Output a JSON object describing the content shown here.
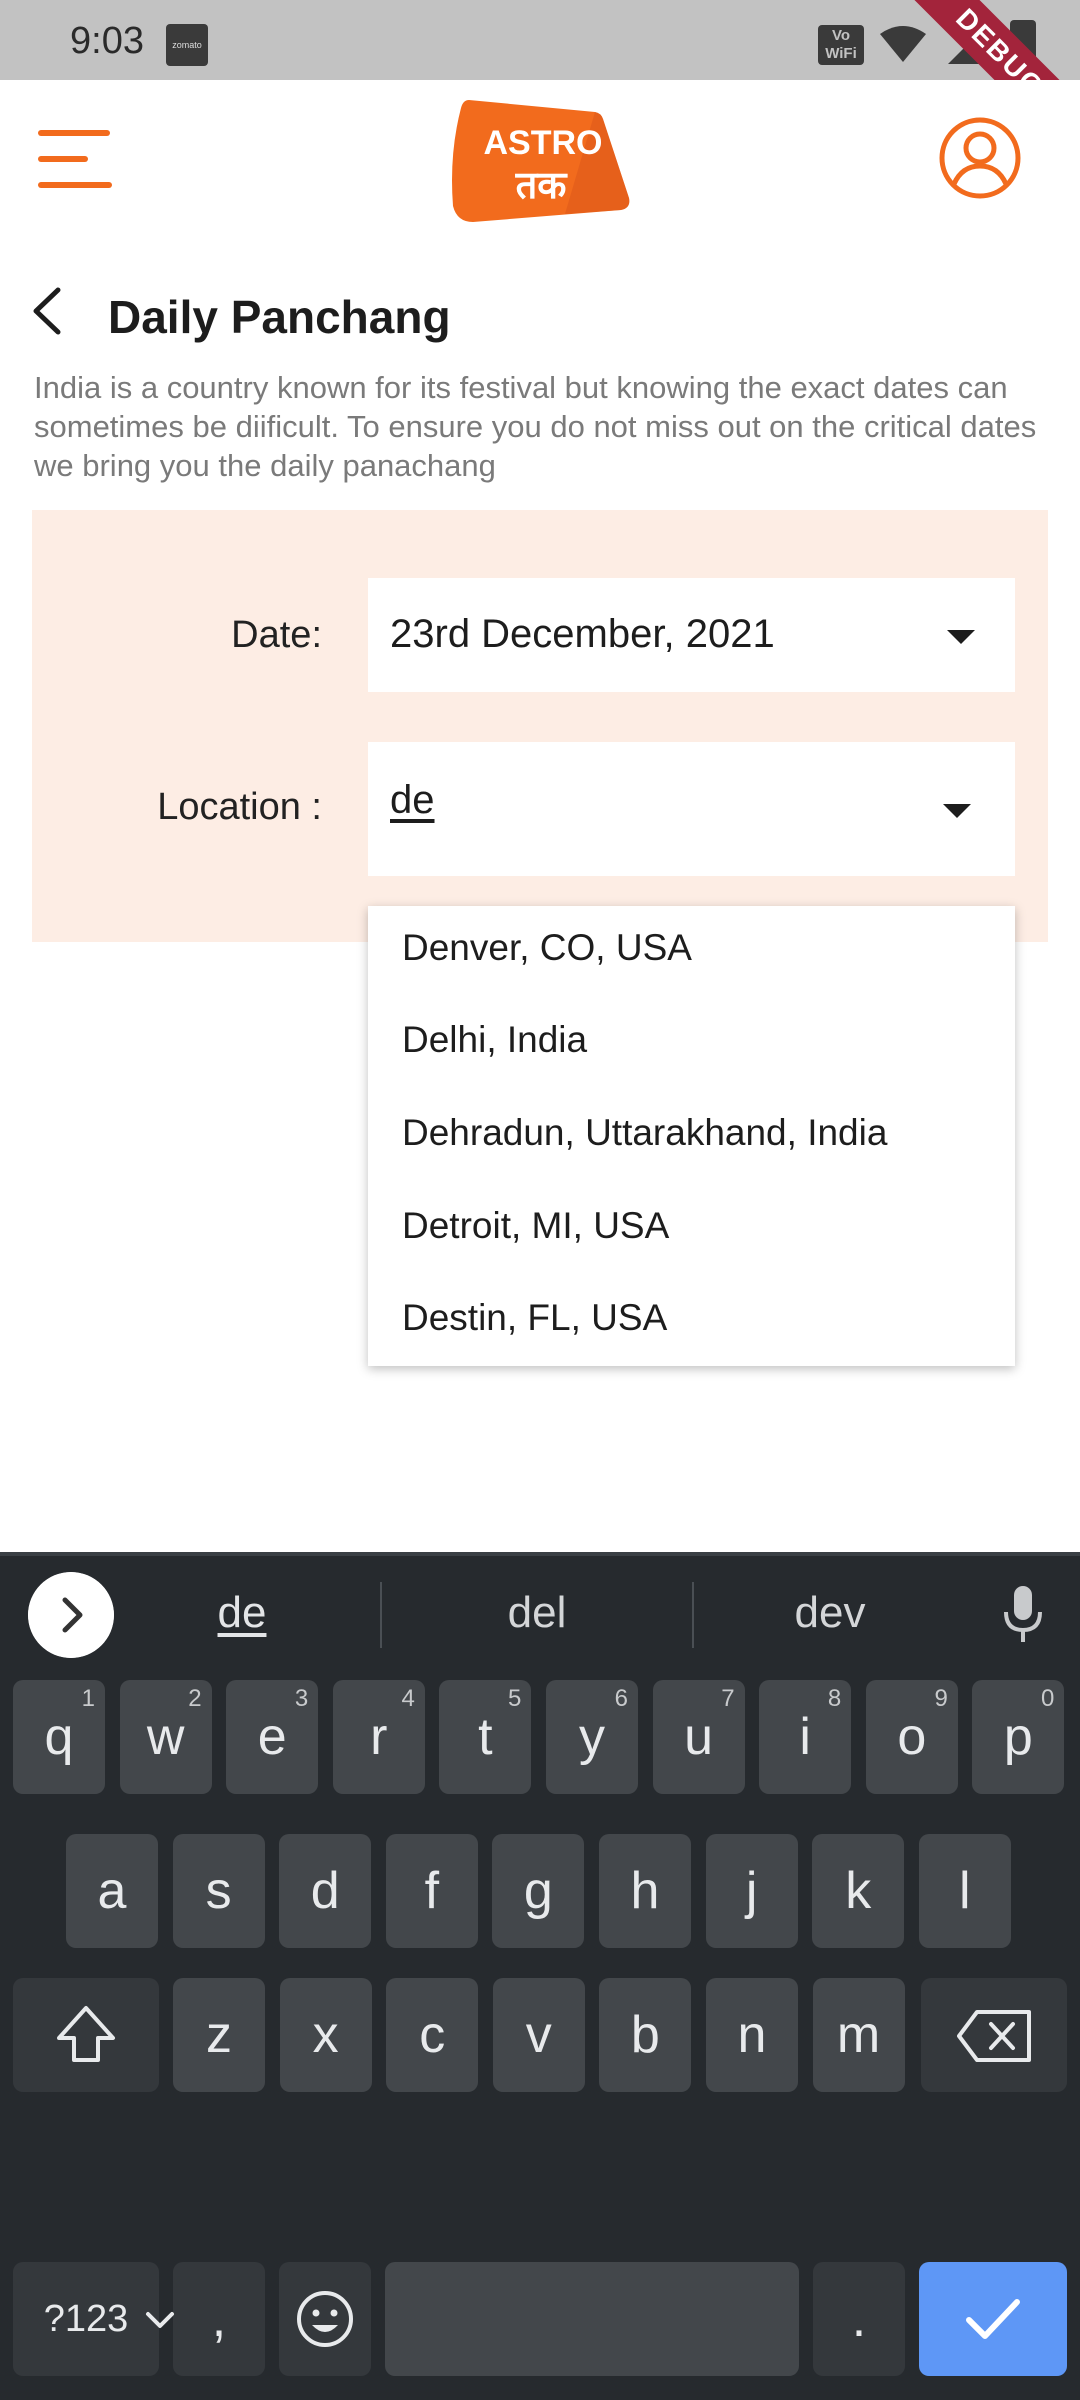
{
  "status_bar": {
    "time": "9:03",
    "notif_app": "zomato",
    "volte": "Vo WiFi"
  },
  "debug_ribbon": "DEBUG",
  "header": {
    "logo_top": "ASTRO",
    "logo_bottom": "तक"
  },
  "page": {
    "title": "Daily Panchang",
    "description": "India is a country known for its festival but knowing the exact dates can sometimes be diificult. To ensure you do not miss out on the critical dates we bring you the daily panachang"
  },
  "form": {
    "date_label": "Date:",
    "date_value": "23rd December, 2021",
    "location_label": "Location :",
    "location_value": "de"
  },
  "dropdown": {
    "options": [
      "Denver, CO, USA",
      "Delhi, India",
      "Dehradun, Uttarakhand, India",
      "Detroit, MI, USA",
      "Destin, FL, USA"
    ]
  },
  "keyboard": {
    "suggestions": [
      "de",
      "del",
      "dev"
    ],
    "row1": [
      {
        "k": "q",
        "h": "1"
      },
      {
        "k": "w",
        "h": "2"
      },
      {
        "k": "e",
        "h": "3"
      },
      {
        "k": "r",
        "h": "4"
      },
      {
        "k": "t",
        "h": "5"
      },
      {
        "k": "y",
        "h": "6"
      },
      {
        "k": "u",
        "h": "7"
      },
      {
        "k": "i",
        "h": "8"
      },
      {
        "k": "o",
        "h": "9"
      },
      {
        "k": "p",
        "h": "0"
      }
    ],
    "row2": [
      "a",
      "s",
      "d",
      "f",
      "g",
      "h",
      "j",
      "k",
      "l"
    ],
    "row3": [
      "z",
      "x",
      "c",
      "v",
      "b",
      "n",
      "m"
    ],
    "symbols_label": "?123",
    "comma": ",",
    "period": "."
  },
  "colors": {
    "brand": "#f26b1d",
    "panel": "#fdede4",
    "action_key": "#5e97f6"
  }
}
